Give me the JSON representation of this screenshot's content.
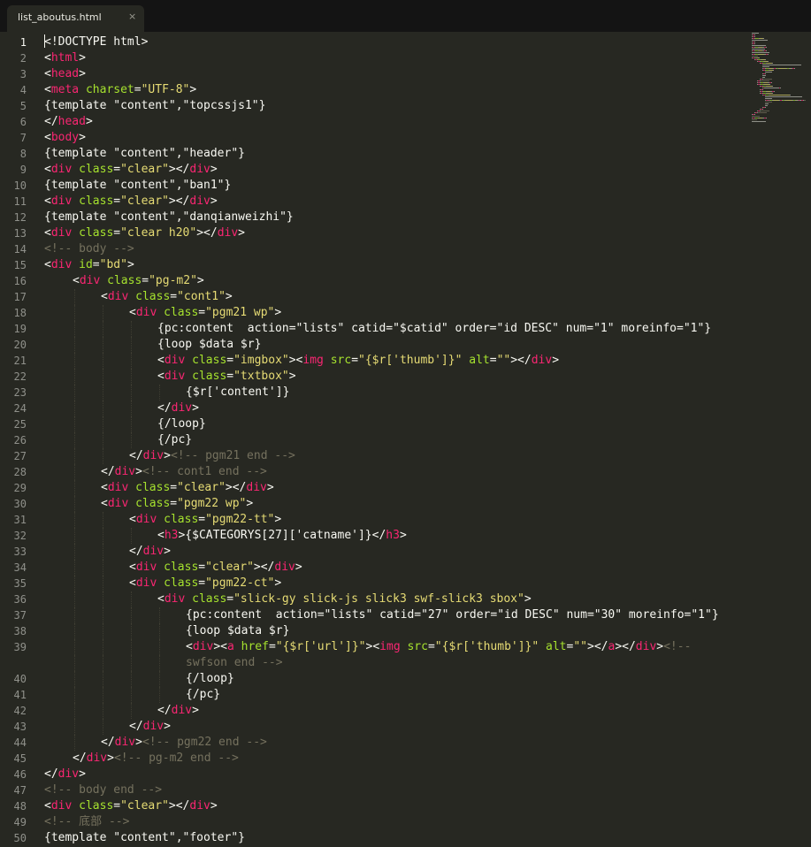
{
  "tab": {
    "title": "list_aboutus.html",
    "close_glyph": "×"
  },
  "theme": {
    "background": "#272822",
    "tag": "#f92672",
    "attr": "#a6e22e",
    "string": "#e6db74",
    "comment": "#75715e",
    "text": "#f8f8f2",
    "gutter": "#8f908a"
  },
  "lines": [
    {
      "n": "1",
      "indent": 0,
      "tokens": [
        [
          "p",
          "<!DOCTYPE html>"
        ]
      ]
    },
    {
      "n": "2",
      "indent": 0,
      "tokens": [
        [
          "p",
          "<"
        ],
        [
          "t",
          "html"
        ],
        [
          "p",
          ">"
        ]
      ]
    },
    {
      "n": "3",
      "indent": 0,
      "tokens": [
        [
          "p",
          "<"
        ],
        [
          "t",
          "head"
        ],
        [
          "p",
          ">"
        ]
      ]
    },
    {
      "n": "4",
      "indent": 0,
      "tokens": [
        [
          "p",
          "<"
        ],
        [
          "t",
          "meta"
        ],
        [
          "p",
          " "
        ],
        [
          "a",
          "charset"
        ],
        [
          "p",
          "="
        ],
        [
          "s",
          "\"UTF-8\""
        ],
        [
          "p",
          ">"
        ]
      ]
    },
    {
      "n": "5",
      "indent": 0,
      "tokens": [
        [
          "p",
          "{template \"content\",\"topcssjs1\"}"
        ]
      ]
    },
    {
      "n": "6",
      "indent": 0,
      "tokens": [
        [
          "p",
          "</"
        ],
        [
          "t",
          "head"
        ],
        [
          "p",
          ">"
        ]
      ]
    },
    {
      "n": "7",
      "indent": 0,
      "tokens": [
        [
          "p",
          "<"
        ],
        [
          "t",
          "body"
        ],
        [
          "p",
          ">"
        ]
      ]
    },
    {
      "n": "8",
      "indent": 0,
      "tokens": [
        [
          "p",
          "{template \"content\",\"header\"}"
        ]
      ]
    },
    {
      "n": "9",
      "indent": 0,
      "tokens": [
        [
          "p",
          "<"
        ],
        [
          "t",
          "div"
        ],
        [
          "p",
          " "
        ],
        [
          "a",
          "class"
        ],
        [
          "p",
          "="
        ],
        [
          "s",
          "\"clear\""
        ],
        [
          "p",
          "></"
        ],
        [
          "t",
          "div"
        ],
        [
          "p",
          ">"
        ]
      ]
    },
    {
      "n": "10",
      "indent": 0,
      "tokens": [
        [
          "p",
          "{template \"content\",\"ban1\"}"
        ]
      ]
    },
    {
      "n": "11",
      "indent": 0,
      "tokens": [
        [
          "p",
          "<"
        ],
        [
          "t",
          "div"
        ],
        [
          "p",
          " "
        ],
        [
          "a",
          "class"
        ],
        [
          "p",
          "="
        ],
        [
          "s",
          "\"clear\""
        ],
        [
          "p",
          "></"
        ],
        [
          "t",
          "div"
        ],
        [
          "p",
          ">"
        ]
      ]
    },
    {
      "n": "12",
      "indent": 0,
      "tokens": [
        [
          "p",
          "{template \"content\",\"danqianweizhi\"}"
        ]
      ]
    },
    {
      "n": "13",
      "indent": 0,
      "tokens": [
        [
          "p",
          "<"
        ],
        [
          "t",
          "div"
        ],
        [
          "p",
          " "
        ],
        [
          "a",
          "class"
        ],
        [
          "p",
          "="
        ],
        [
          "s",
          "\"clear h20\""
        ],
        [
          "p",
          "></"
        ],
        [
          "t",
          "div"
        ],
        [
          "p",
          ">"
        ]
      ]
    },
    {
      "n": "14",
      "indent": 0,
      "tokens": [
        [
          "c",
          "<!-- body -->"
        ]
      ]
    },
    {
      "n": "15",
      "indent": 0,
      "tokens": [
        [
          "p",
          "<"
        ],
        [
          "t",
          "div"
        ],
        [
          "p",
          " "
        ],
        [
          "a",
          "id"
        ],
        [
          "p",
          "="
        ],
        [
          "s",
          "\"bd\""
        ],
        [
          "p",
          ">"
        ]
      ]
    },
    {
      "n": "16",
      "indent": 1,
      "tokens": [
        [
          "p",
          "<"
        ],
        [
          "t",
          "div"
        ],
        [
          "p",
          " "
        ],
        [
          "a",
          "class"
        ],
        [
          "p",
          "="
        ],
        [
          "s",
          "\"pg-m2\""
        ],
        [
          "p",
          ">"
        ]
      ]
    },
    {
      "n": "17",
      "indent": 2,
      "tokens": [
        [
          "p",
          "<"
        ],
        [
          "t",
          "div"
        ],
        [
          "p",
          " "
        ],
        [
          "a",
          "class"
        ],
        [
          "p",
          "="
        ],
        [
          "s",
          "\"cont1\""
        ],
        [
          "p",
          ">"
        ]
      ]
    },
    {
      "n": "18",
      "indent": 3,
      "tokens": [
        [
          "p",
          "<"
        ],
        [
          "t",
          "div"
        ],
        [
          "p",
          " "
        ],
        [
          "a",
          "class"
        ],
        [
          "p",
          "="
        ],
        [
          "s",
          "\"pgm21 wp\""
        ],
        [
          "p",
          ">"
        ]
      ]
    },
    {
      "n": "19",
      "indent": 4,
      "tokens": [
        [
          "p",
          "{pc:content  action=\"lists\" catid=\"$catid\" order=\"id DESC\" num=\"1\" moreinfo=\"1\"}"
        ]
      ]
    },
    {
      "n": "20",
      "indent": 4,
      "tokens": [
        [
          "p",
          "{loop $data $r}"
        ]
      ]
    },
    {
      "n": "21",
      "indent": 4,
      "tokens": [
        [
          "p",
          "<"
        ],
        [
          "t",
          "div"
        ],
        [
          "p",
          " "
        ],
        [
          "a",
          "class"
        ],
        [
          "p",
          "="
        ],
        [
          "s",
          "\"imgbox\""
        ],
        [
          "p",
          "><"
        ],
        [
          "t",
          "img"
        ],
        [
          "p",
          " "
        ],
        [
          "a",
          "src"
        ],
        [
          "p",
          "="
        ],
        [
          "s",
          "\"{$r['thumb']}\""
        ],
        [
          "p",
          " "
        ],
        [
          "a",
          "alt"
        ],
        [
          "p",
          "="
        ],
        [
          "s",
          "\"\""
        ],
        [
          "p",
          "></"
        ],
        [
          "t",
          "div"
        ],
        [
          "p",
          ">"
        ]
      ]
    },
    {
      "n": "22",
      "indent": 4,
      "tokens": [
        [
          "p",
          "<"
        ],
        [
          "t",
          "div"
        ],
        [
          "p",
          " "
        ],
        [
          "a",
          "class"
        ],
        [
          "p",
          "="
        ],
        [
          "s",
          "\"txtbox\""
        ],
        [
          "p",
          ">"
        ]
      ]
    },
    {
      "n": "23",
      "indent": 5,
      "tokens": [
        [
          "p",
          "{$r['content']}"
        ]
      ]
    },
    {
      "n": "24",
      "indent": 4,
      "tokens": [
        [
          "p",
          "</"
        ],
        [
          "t",
          "div"
        ],
        [
          "p",
          ">"
        ]
      ]
    },
    {
      "n": "25",
      "indent": 4,
      "tokens": [
        [
          "p",
          "{/loop}"
        ]
      ]
    },
    {
      "n": "26",
      "indent": 4,
      "tokens": [
        [
          "p",
          "{/pc}"
        ]
      ]
    },
    {
      "n": "27",
      "indent": 3,
      "tokens": [
        [
          "p",
          "</"
        ],
        [
          "t",
          "div"
        ],
        [
          "p",
          ">"
        ],
        [
          "c",
          "<!-- pgm21 end -->"
        ]
      ]
    },
    {
      "n": "28",
      "indent": 2,
      "tokens": [
        [
          "p",
          "</"
        ],
        [
          "t",
          "div"
        ],
        [
          "p",
          ">"
        ],
        [
          "c",
          "<!-- cont1 end -->"
        ]
      ]
    },
    {
      "n": "29",
      "indent": 2,
      "tokens": [
        [
          "p",
          "<"
        ],
        [
          "t",
          "div"
        ],
        [
          "p",
          " "
        ],
        [
          "a",
          "class"
        ],
        [
          "p",
          "="
        ],
        [
          "s",
          "\"clear\""
        ],
        [
          "p",
          "></"
        ],
        [
          "t",
          "div"
        ],
        [
          "p",
          ">"
        ]
      ]
    },
    {
      "n": "30",
      "indent": 2,
      "tokens": [
        [
          "p",
          "<"
        ],
        [
          "t",
          "div"
        ],
        [
          "p",
          " "
        ],
        [
          "a",
          "class"
        ],
        [
          "p",
          "="
        ],
        [
          "s",
          "\"pgm22 wp\""
        ],
        [
          "p",
          ">"
        ]
      ]
    },
    {
      "n": "31",
      "indent": 3,
      "tokens": [
        [
          "p",
          "<"
        ],
        [
          "t",
          "div"
        ],
        [
          "p",
          " "
        ],
        [
          "a",
          "class"
        ],
        [
          "p",
          "="
        ],
        [
          "s",
          "\"pgm22-tt\""
        ],
        [
          "p",
          ">"
        ]
      ]
    },
    {
      "n": "32",
      "indent": 4,
      "tokens": [
        [
          "p",
          "<"
        ],
        [
          "t",
          "h3"
        ],
        [
          "p",
          ">{$CATEGORYS[27]['catname']}</"
        ],
        [
          "t",
          "h3"
        ],
        [
          "p",
          ">"
        ]
      ]
    },
    {
      "n": "33",
      "indent": 3,
      "tokens": [
        [
          "p",
          "</"
        ],
        [
          "t",
          "div"
        ],
        [
          "p",
          ">"
        ]
      ]
    },
    {
      "n": "34",
      "indent": 3,
      "tokens": [
        [
          "p",
          "<"
        ],
        [
          "t",
          "div"
        ],
        [
          "p",
          " "
        ],
        [
          "a",
          "class"
        ],
        [
          "p",
          "="
        ],
        [
          "s",
          "\"clear\""
        ],
        [
          "p",
          "></"
        ],
        [
          "t",
          "div"
        ],
        [
          "p",
          ">"
        ]
      ]
    },
    {
      "n": "35",
      "indent": 3,
      "tokens": [
        [
          "p",
          "<"
        ],
        [
          "t",
          "div"
        ],
        [
          "p",
          " "
        ],
        [
          "a",
          "class"
        ],
        [
          "p",
          "="
        ],
        [
          "s",
          "\"pgm22-ct\""
        ],
        [
          "p",
          ">"
        ]
      ]
    },
    {
      "n": "36",
      "indent": 4,
      "tokens": [
        [
          "p",
          "<"
        ],
        [
          "t",
          "div"
        ],
        [
          "p",
          " "
        ],
        [
          "a",
          "class"
        ],
        [
          "p",
          "="
        ],
        [
          "s",
          "\"slick-gy slick-js slick3 swf-slick3 sbox\""
        ],
        [
          "p",
          ">"
        ]
      ]
    },
    {
      "n": "37",
      "indent": 5,
      "tokens": [
        [
          "p",
          "{pc:content  action=\"lists\" catid=\"27\" order=\"id DESC\" num=\"30\" moreinfo=\"1\"}"
        ]
      ]
    },
    {
      "n": "38",
      "indent": 5,
      "tokens": [
        [
          "p",
          "{loop $data $r}"
        ]
      ]
    },
    {
      "n": "39",
      "indent": 5,
      "tokens": [
        [
          "p",
          "<"
        ],
        [
          "t",
          "div"
        ],
        [
          "p",
          "><"
        ],
        [
          "t",
          "a"
        ],
        [
          "p",
          " "
        ],
        [
          "a",
          "href"
        ],
        [
          "p",
          "="
        ],
        [
          "s",
          "\"{$r['url']}\""
        ],
        [
          "p",
          "><"
        ],
        [
          "t",
          "img"
        ],
        [
          "p",
          " "
        ],
        [
          "a",
          "src"
        ],
        [
          "p",
          "="
        ],
        [
          "s",
          "\"{$r['thumb']}\""
        ],
        [
          "p",
          " "
        ],
        [
          "a",
          "alt"
        ],
        [
          "p",
          "="
        ],
        [
          "s",
          "\"\""
        ],
        [
          "p",
          "></"
        ],
        [
          "t",
          "a"
        ],
        [
          "p",
          "></"
        ],
        [
          "t",
          "div"
        ],
        [
          "p",
          ">"
        ],
        [
          "c",
          "<!--"
        ]
      ]
    },
    {
      "n": "",
      "indent": 5,
      "tokens": [
        [
          "c",
          "swfson end -->"
        ]
      ]
    },
    {
      "n": "40",
      "indent": 5,
      "tokens": [
        [
          "p",
          "{/loop}"
        ]
      ]
    },
    {
      "n": "41",
      "indent": 5,
      "tokens": [
        [
          "p",
          "{/pc}"
        ]
      ]
    },
    {
      "n": "42",
      "indent": 4,
      "tokens": [
        [
          "p",
          "</"
        ],
        [
          "t",
          "div"
        ],
        [
          "p",
          ">"
        ]
      ]
    },
    {
      "n": "43",
      "indent": 3,
      "tokens": [
        [
          "p",
          "</"
        ],
        [
          "t",
          "div"
        ],
        [
          "p",
          ">"
        ]
      ]
    },
    {
      "n": "44",
      "indent": 2,
      "tokens": [
        [
          "p",
          "</"
        ],
        [
          "t",
          "div"
        ],
        [
          "p",
          ">"
        ],
        [
          "c",
          "<!-- pgm22 end -->"
        ]
      ]
    },
    {
      "n": "45",
      "indent": 1,
      "tokens": [
        [
          "p",
          "</"
        ],
        [
          "t",
          "div"
        ],
        [
          "p",
          ">"
        ],
        [
          "c",
          "<!-- pg-m2 end -->"
        ]
      ]
    },
    {
      "n": "46",
      "indent": 0,
      "tokens": [
        [
          "p",
          "</"
        ],
        [
          "t",
          "div"
        ],
        [
          "p",
          ">"
        ]
      ]
    },
    {
      "n": "47",
      "indent": 0,
      "tokens": [
        [
          "c",
          "<!-- body end -->"
        ]
      ]
    },
    {
      "n": "48",
      "indent": 0,
      "tokens": [
        [
          "p",
          "<"
        ],
        [
          "t",
          "div"
        ],
        [
          "p",
          " "
        ],
        [
          "a",
          "class"
        ],
        [
          "p",
          "="
        ],
        [
          "s",
          "\"clear\""
        ],
        [
          "p",
          "></"
        ],
        [
          "t",
          "div"
        ],
        [
          "p",
          ">"
        ]
      ]
    },
    {
      "n": "49",
      "indent": 0,
      "tokens": [
        [
          "c",
          "<!-- 底部 -->"
        ]
      ]
    },
    {
      "n": "50",
      "indent": 0,
      "tokens": [
        [
          "p",
          "{template \"content\",\"footer\"}"
        ]
      ]
    }
  ]
}
